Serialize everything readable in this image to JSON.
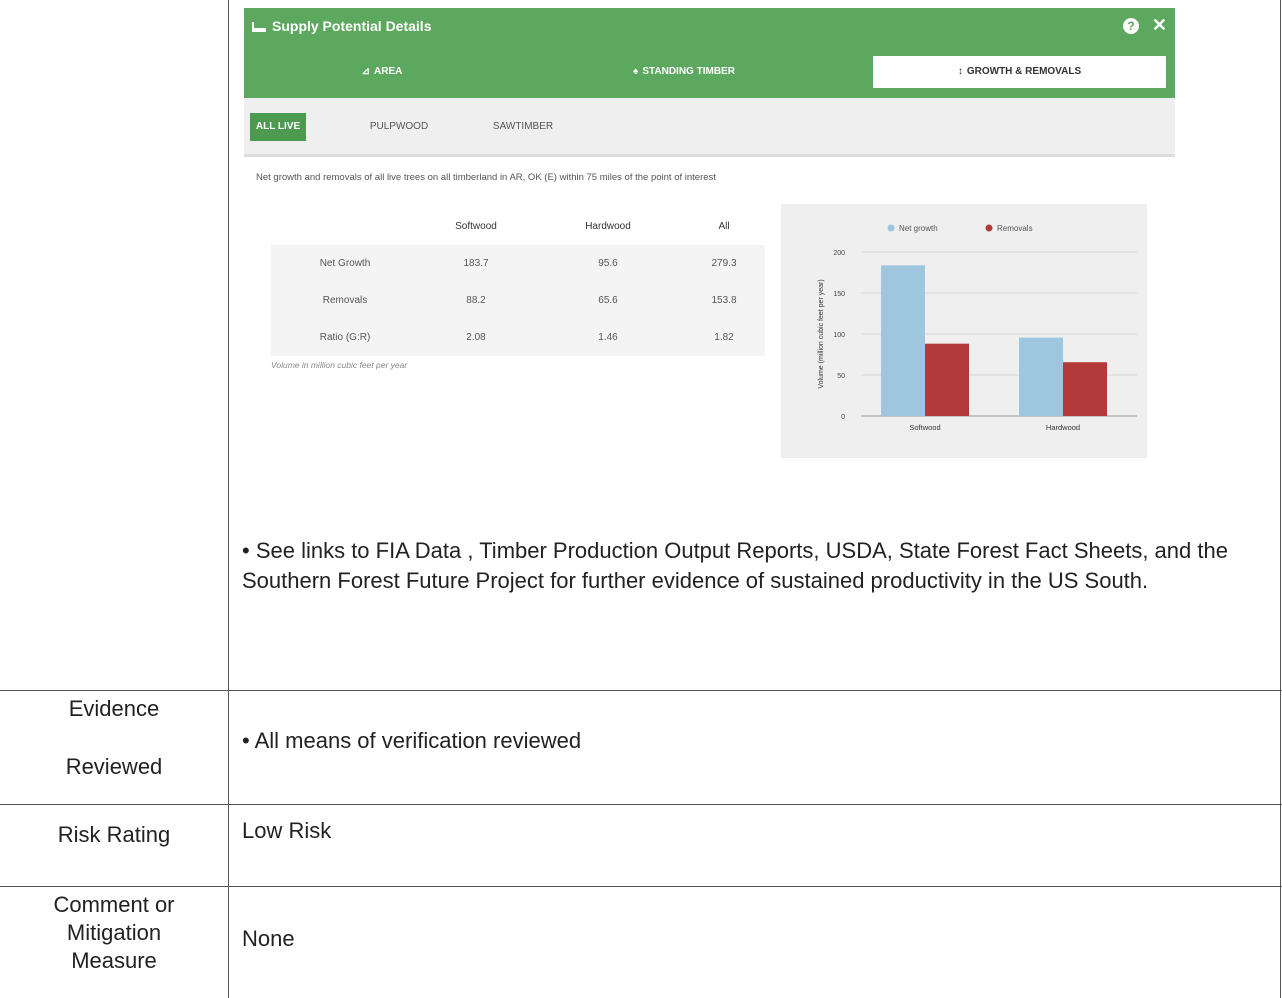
{
  "app": {
    "title": "Supply Potential Details",
    "help_glyph": "?",
    "close_glyph": "✕",
    "tabs": [
      {
        "label": "AREA",
        "icon": "area-icon",
        "glyph": "⊿"
      },
      {
        "label": "STANDING TIMBER",
        "icon": "tree-icon",
        "glyph": "♠"
      },
      {
        "label": "GROWTH & REMOVALS",
        "icon": "updown-arrow-icon",
        "glyph": "↕"
      }
    ],
    "subtabs": [
      "ALL LIVE",
      "PULPWOOD",
      "SAWTIMBER"
    ],
    "description": "Net growth and removals of all live trees on all timberland in AR, OK (E) within 75 miles of the point of interest",
    "table": {
      "headers": [
        "",
        "Softwood",
        "Hardwood",
        "All"
      ],
      "rows": [
        [
          "Net Growth",
          "183.7",
          "95.6",
          "279.3"
        ],
        [
          "Removals",
          "88.2",
          "65.6",
          "153.8"
        ],
        [
          "Ratio (G:R)",
          "2.08",
          "1.46",
          "1.82"
        ]
      ]
    },
    "table_note": "Volume in million cubic feet per year"
  },
  "chart_data": {
    "type": "bar",
    "categories": [
      "Softwood",
      "Hardwood"
    ],
    "series": [
      {
        "name": "Net growth",
        "values": [
          183.7,
          95.6
        ],
        "color": "#9ec6df"
      },
      {
        "name": "Removals",
        "values": [
          88.2,
          65.6
        ],
        "color": "#b33a3a"
      }
    ],
    "ylabel": "Volume (million cubic feet per year)",
    "ylim": [
      0,
      200
    ],
    "yticks": [
      "0",
      "50",
      "100",
      "150",
      "200"
    ],
    "legend": "top",
    "grid": true
  },
  "doc": {
    "bullet_links": "• See links to FIA Data , Timber Production Output Reports, USDA, State Forest Fact Sheets, and the Southern Forest Future Project for further evidence of sustained productivity in the US South.",
    "rows": [
      {
        "label_line1": "Evidence",
        "label_line2": "Reviewed",
        "value": "• All means of verification reviewed"
      },
      {
        "label": "Risk Rating",
        "value": "Low Risk"
      },
      {
        "label_line1": "Comment or",
        "label_line2": "Mitigation",
        "label_line3": "Measure",
        "value": "None"
      }
    ]
  }
}
